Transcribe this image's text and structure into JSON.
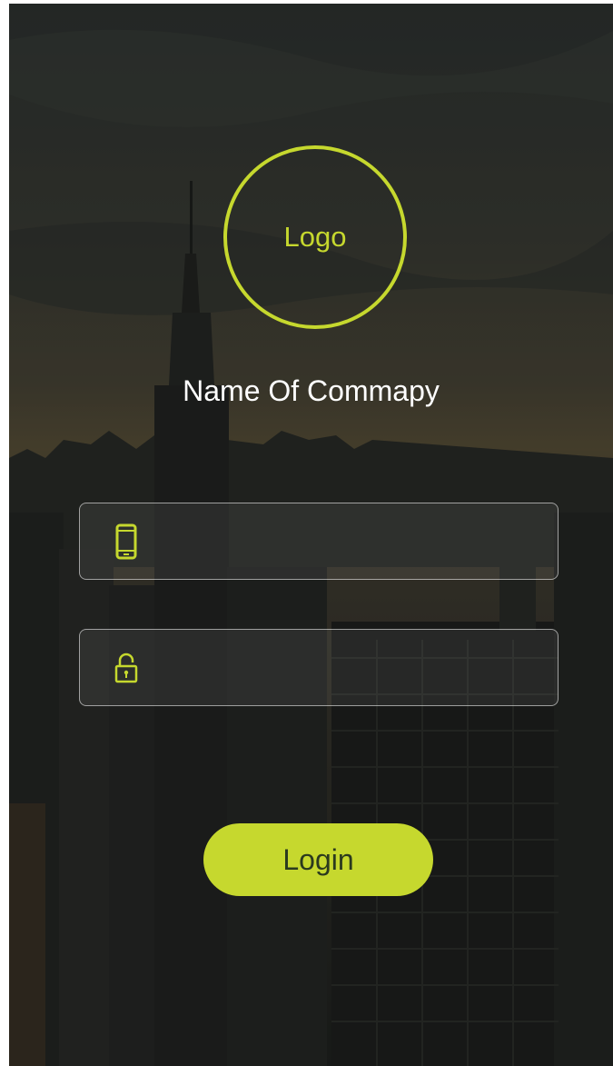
{
  "logo": {
    "text": "Logo"
  },
  "company": {
    "name": "Name Of Commapy"
  },
  "phone_field": {
    "icon": "phone-icon",
    "value": "",
    "placeholder": ""
  },
  "password_field": {
    "icon": "lock-icon",
    "value": "",
    "placeholder": ""
  },
  "login_button": {
    "label": "Login"
  },
  "colors": {
    "accent": "#c6d82e",
    "text": "#ffffff",
    "background": "#2a2b2a"
  }
}
